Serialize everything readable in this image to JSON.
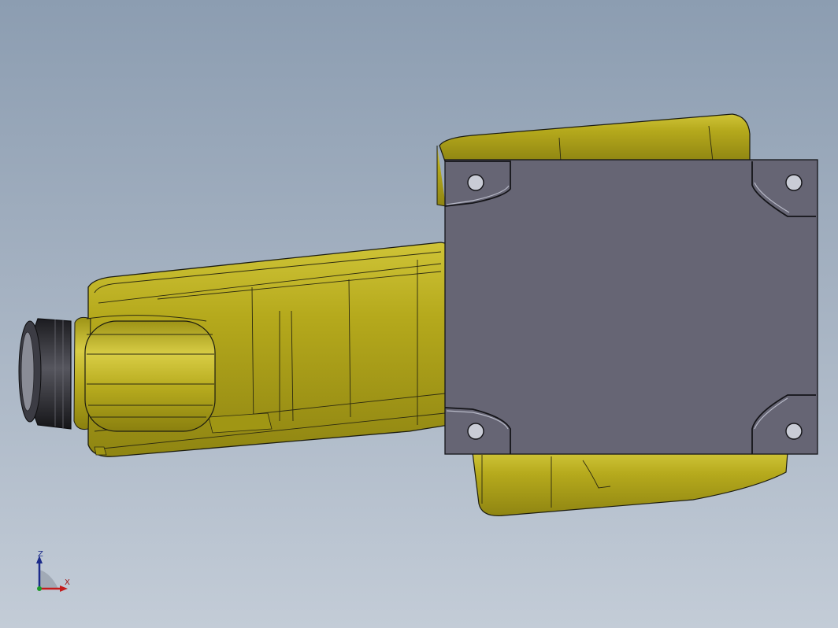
{
  "scene": {
    "background_top": "#8c9db1",
    "background_bottom": "#c3ccd7",
    "body_color": "#b5a91c",
    "body_shadow": "#8f8512",
    "flange_color": "#666574",
    "hole_color": "#c9ccd6",
    "wrist_color": "#2a2a2e"
  },
  "triad": {
    "z_label": "Z",
    "x_label": "X",
    "z_color": "#1b2a8a",
    "x_color": "#c41b1b",
    "y_color": "#1e9a2a"
  }
}
